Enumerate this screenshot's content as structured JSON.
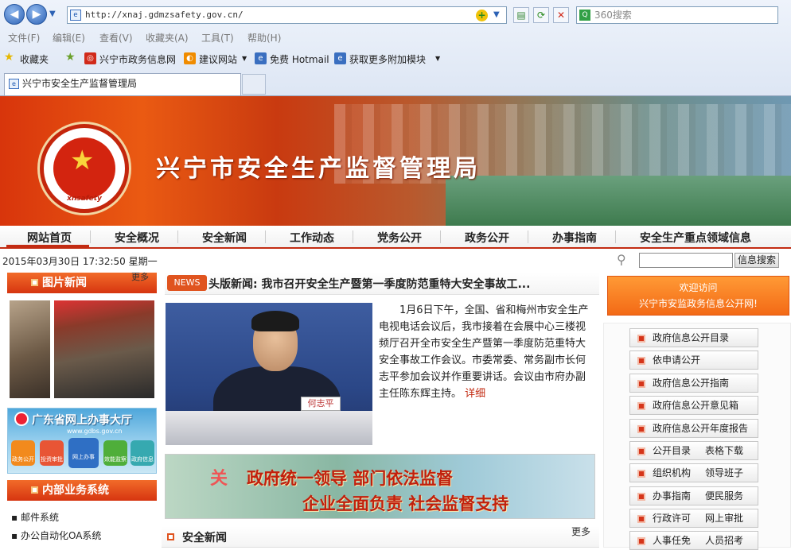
{
  "browser": {
    "url": "http://xnaj.gdmzsafety.gov.cn/",
    "search_placeholder": "360搜索",
    "menu": [
      "文件(F)",
      "编辑(E)",
      "查看(V)",
      "收藏夹(A)",
      "工具(T)",
      "帮助(H)"
    ],
    "favorites": {
      "label": "收藏夹",
      "items": [
        "兴宁市政务信息网",
        "建议网站",
        "免费 Hotmail",
        "获取更多附加模块"
      ]
    },
    "tab_title": "兴宁市安全生产监督管理局"
  },
  "site": {
    "title": "兴宁市安全生产监督管理局",
    "emblem_text": "xnsafety",
    "nav": [
      "网站首页",
      "安全概况",
      "安全新闻",
      "工作动态",
      "党务公开",
      "政务公开",
      "办事指南",
      "安全生产重点领域信息"
    ],
    "date": "2015年03月30日 17:32:50  星期一",
    "search_button": "信息搜索",
    "left": {
      "photo_news": "图片新闻",
      "more": "更多",
      "gd_title": "广东省网上办事大厅",
      "gd_url": "www.gdbs.gov.cn",
      "gd_icons": [
        "政务公开",
        "投资审批",
        "网上办事",
        "效能监察",
        "政府信息"
      ],
      "internal": "内部业务系统",
      "links": [
        "邮件系统",
        "办公自动化OA系统"
      ]
    },
    "headline": {
      "badge": "NEWS",
      "title": "头版新闻: 我市召开安全生产暨第一季度防范重特大安全事故工...",
      "nameplate": "何志平",
      "body": "1月6日下午，全国、省和梅州市安全生产电视电话会议后，我市接着在会展中心三楼视频厅召开全市安全生产暨第一季度防范重特大安全事故工作会议。市委常委、常务副市长何志平参加会议并作重要讲话。会议由市府办副主任陈东辉主持。",
      "more": "详细"
    },
    "slogan": {
      "line1": "政府统一领导  部门依法监督",
      "line2": "企业全面负责  社会监督支持",
      "fragment": "关"
    },
    "safety_news": {
      "title": "安全新闻",
      "more": "更多"
    },
    "right": {
      "welcome1": "欢迎访问",
      "welcome2": "兴宁市安监政务信息公开网!",
      "buttons": [
        {
          "a": "政府信息公开目录"
        },
        {
          "a": "依申请公开"
        },
        {
          "a": "政府信息公开指南"
        },
        {
          "a": "政府信息公开意见箱"
        },
        {
          "a": "政府信息公开年度报告"
        },
        {
          "a": "公开目录",
          "b": "表格下载"
        },
        {
          "a": "组织机构",
          "b": "领导班子"
        },
        {
          "a": "办事指南",
          "b": "便民服务"
        },
        {
          "a": "行政许可",
          "b": "网上审批"
        },
        {
          "a": "人事任免",
          "b": "人员招考"
        }
      ]
    }
  }
}
